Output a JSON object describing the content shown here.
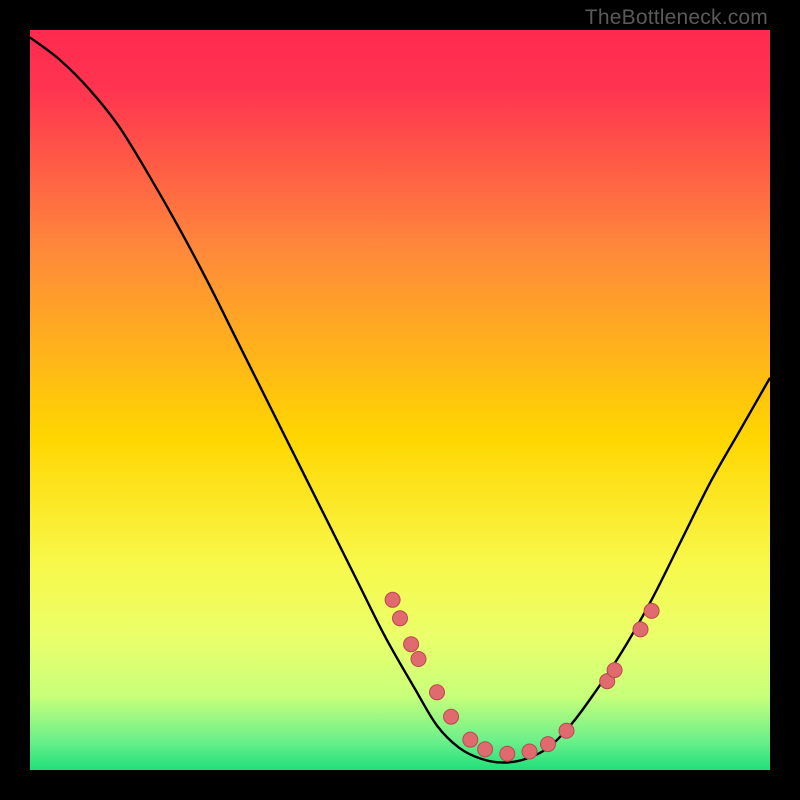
{
  "watermark": "TheBottleneck.com",
  "colors": {
    "bg_black": "#000000",
    "grad_top": "#ff2a4f",
    "grad_mid": "#ffd600",
    "grad_low": "#f3ff6a",
    "grad_green": "#1fe07a",
    "curve": "#000000",
    "dot_fill": "#e06a6d",
    "dot_stroke": "#b84a50"
  },
  "chart_data": {
    "type": "line",
    "title": "",
    "xlabel": "",
    "ylabel": "",
    "xlim": [
      0,
      100
    ],
    "ylim": [
      0,
      100
    ],
    "curve": {
      "x": [
        0,
        4,
        8,
        12,
        16,
        20,
        24,
        28,
        32,
        36,
        40,
        44,
        48,
        52,
        55,
        58,
        61,
        64,
        67,
        70,
        73,
        76,
        80,
        84,
        88,
        92,
        96,
        100
      ],
      "y": [
        99,
        96,
        92,
        87,
        80.5,
        73.5,
        66,
        58,
        50,
        42,
        34,
        26,
        18,
        11,
        6,
        3,
        1.5,
        1,
        1.5,
        3,
        6,
        10,
        16,
        23,
        31,
        39,
        46,
        53
      ]
    },
    "dots": [
      {
        "x": 49.0,
        "y": 23.0
      },
      {
        "x": 50.0,
        "y": 20.5
      },
      {
        "x": 51.5,
        "y": 17.0
      },
      {
        "x": 52.5,
        "y": 15.0
      },
      {
        "x": 55.0,
        "y": 10.5
      },
      {
        "x": 56.9,
        "y": 7.2
      },
      {
        "x": 59.5,
        "y": 4.1
      },
      {
        "x": 61.5,
        "y": 2.8
      },
      {
        "x": 64.5,
        "y": 2.2
      },
      {
        "x": 67.5,
        "y": 2.5
      },
      {
        "x": 70.0,
        "y": 3.5
      },
      {
        "x": 72.5,
        "y": 5.3
      },
      {
        "x": 78.0,
        "y": 12.0
      },
      {
        "x": 79.0,
        "y": 13.5
      },
      {
        "x": 82.5,
        "y": 19.0
      },
      {
        "x": 84.0,
        "y": 21.5
      }
    ],
    "gradient_stops": [
      {
        "offset": 0.0,
        "color": "#ff2a4f"
      },
      {
        "offset": 0.08,
        "color": "#ff3450"
      },
      {
        "offset": 0.3,
        "color": "#ff8a3a"
      },
      {
        "offset": 0.55,
        "color": "#ffd600"
      },
      {
        "offset": 0.72,
        "color": "#f8f84a"
      },
      {
        "offset": 0.82,
        "color": "#eaff6a"
      },
      {
        "offset": 0.9,
        "color": "#c8ff7a"
      },
      {
        "offset": 0.96,
        "color": "#6cf08a"
      },
      {
        "offset": 1.0,
        "color": "#1fe07a"
      }
    ]
  }
}
